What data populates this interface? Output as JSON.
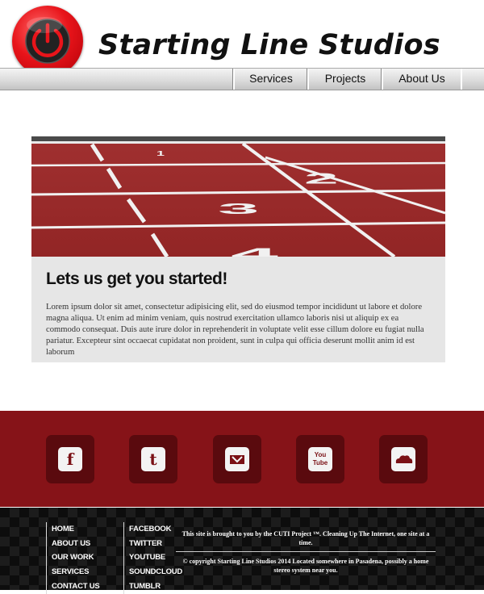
{
  "header": {
    "site_title": "Starting Line Studios",
    "logo_icon": "power-button-icon"
  },
  "nav": {
    "items": [
      {
        "label": "Services"
      },
      {
        "label": "Projects"
      },
      {
        "label": "About Us"
      }
    ]
  },
  "hero": {
    "image": "running-track-lanes-photo",
    "lane_numbers": [
      "1",
      "2",
      "3",
      "4"
    ]
  },
  "content": {
    "title": "Lets us get you started!",
    "body": "Lorem ipsum dolor sit amet, consectetur adipisicing elit, sed do eiusmod tempor incididunt ut labore et dolore magna aliqua. Ut enim ad minim veniam, quis nostrud exercitation ullamco laboris nisi ut aliquip ex ea commodo consequat. Duis aute irure dolor in reprehenderit in voluptate velit esse cillum dolore eu fugiat nulla pariatur. Excepteur sint occaecat cupidatat non proident, sunt in culpa qui officia deserunt mollit anim id est laborum"
  },
  "social": {
    "buttons": [
      {
        "icon": "facebook-icon",
        "glyph": "f"
      },
      {
        "icon": "tumblr-icon",
        "glyph": "t"
      },
      {
        "icon": "soundcloud-icon",
        "glyph": ""
      },
      {
        "icon": "youtube-icon",
        "glyph": "You Tube"
      },
      {
        "icon": "soundcloud-cloud-icon",
        "glyph": ""
      }
    ]
  },
  "footer": {
    "col1": [
      "HOME",
      "ABOUT US",
      "OUR WORK",
      "SERVICES",
      "CONTACT US"
    ],
    "col2": [
      "FACEBOOK",
      "TWITTER",
      "YOUTUBE",
      "SOUNDCLOUD",
      "TUMBLR"
    ],
    "note_line1": "This site is brought to you by the CUTI Project ™. Cleaning Up The Internet, one site at a time.",
    "note_line2": "© copyright Starting Line Studios 2014 Located somewhere in Pasadena, possibly a home stereo system near you."
  },
  "colors": {
    "brand_red": "#e8141a",
    "band_red": "#861318",
    "footer_bg": "#0d0d0d"
  }
}
